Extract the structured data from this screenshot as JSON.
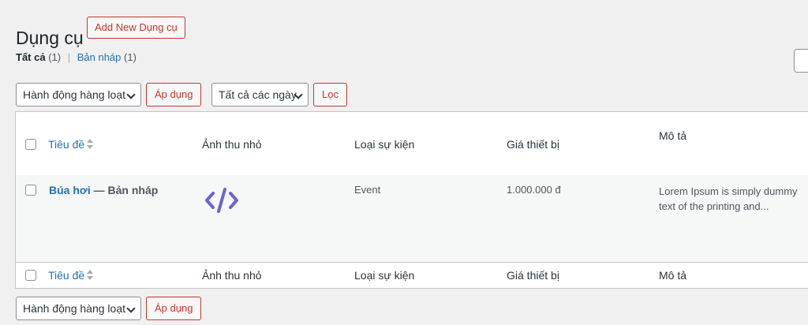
{
  "header": {
    "title": "Dụng cụ",
    "add_new_label": "Add New Dụng cụ"
  },
  "views": {
    "all_label": "Tất cả",
    "all_count": "(1)",
    "separator": "|",
    "draft_label": "Bản nháp",
    "draft_count": "(1)"
  },
  "tablenav_top": {
    "bulk_action": "Hành động hàng loạt",
    "apply_label": "Áp dụng",
    "date_filter": "Tất cả các ngày",
    "filter_label": "Lọc"
  },
  "columns": {
    "title": "Tiêu đề",
    "thumbnail": "Ảnh thu nhỏ",
    "event_type": "Loại sự kiện",
    "price": "Giá thiết bị",
    "description": "Mô tả"
  },
  "rows": [
    {
      "title": "Búa hơi",
      "state": "— Bản nháp",
      "thumbnail_icon": "code-icon",
      "event_type": "Event",
      "price": "1.000.000 đ",
      "description": "Lorem Ipsum is simply dummy text of the printing and..."
    }
  ],
  "tablenav_bottom": {
    "bulk_action": "Hành động hàng loạt",
    "apply_label": "Áp dụng"
  },
  "colors": {
    "accent_red": "#c3372c",
    "link_blue": "#2271b1",
    "icon_purple": "#6a63d8"
  }
}
